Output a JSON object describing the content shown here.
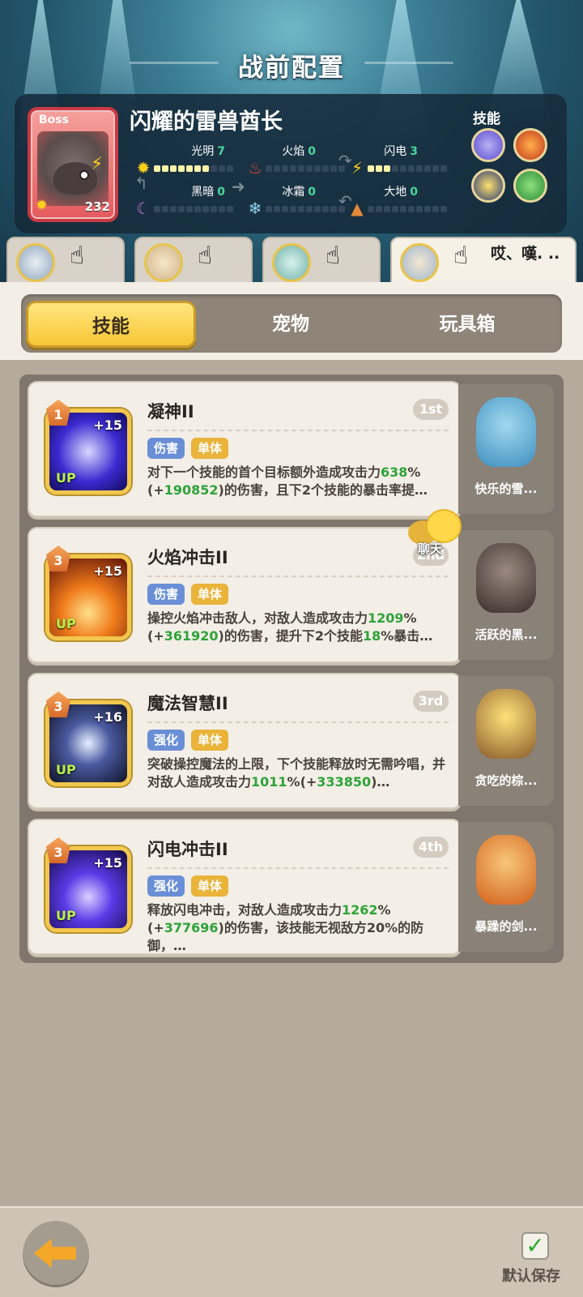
{
  "header": {
    "title": "战前配置"
  },
  "boss": {
    "tag": "Boss",
    "name": "闪耀的雷兽酋长",
    "level": "232",
    "elements": [
      {
        "label": "光明",
        "value": "7",
        "filled": 7,
        "icon": "sun-icon"
      },
      {
        "label": "火焰",
        "value": "0",
        "filled": 0,
        "icon": "fire-icon"
      },
      {
        "label": "闪电",
        "value": "3",
        "filled": 3,
        "icon": "lightning-icon"
      },
      {
        "label": "黑暗",
        "value": "0",
        "filled": 0,
        "icon": "moon-icon"
      },
      {
        "label": "冰霜",
        "value": "0",
        "filled": 0,
        "icon": "snowflake-icon"
      },
      {
        "label": "大地",
        "value": "0",
        "filled": 0,
        "icon": "earth-icon"
      }
    ],
    "skills_label": "技能"
  },
  "party": {
    "note": "哎、嘆. .."
  },
  "tabs": [
    {
      "label": "技能",
      "active": true
    },
    {
      "label": "宠物",
      "active": false
    },
    {
      "label": "玩具箱",
      "active": false
    }
  ],
  "skills": [
    {
      "name": "凝神II",
      "rank": "1st",
      "level": "1",
      "plus": "+15",
      "up": "UP",
      "tags": [
        "伤害",
        "单体"
      ],
      "desc": [
        [
          "对下一个技能的首个目标额外造成攻击力",
          ""
        ],
        [
          "638",
          "g"
        ],
        [
          "%(+",
          ""
        ],
        [
          "190852",
          "g"
        ],
        [
          ")的伤害，且下2个技能的暴击率提…",
          ""
        ]
      ],
      "pet": "快乐的雪..."
    },
    {
      "name": "火焰冲击II",
      "rank": "2nd",
      "level": "3",
      "plus": "+15",
      "up": "UP",
      "tags": [
        "伤害",
        "单体"
      ],
      "desc": [
        [
          "操控火焰冲击敌人，对敌人造成攻击力",
          ""
        ],
        [
          "1209",
          "g"
        ],
        [
          "%(+",
          ""
        ],
        [
          "361920",
          "g"
        ],
        [
          ")的伤害，提升下2个技能",
          ""
        ],
        [
          "18",
          "g"
        ],
        [
          "%暴击…",
          ""
        ]
      ],
      "pet": "活跃的黑..."
    },
    {
      "name": "魔法智慧II",
      "rank": "3rd",
      "level": "3",
      "plus": "+16",
      "up": "UP",
      "tags": [
        "强化",
        "单体"
      ],
      "desc": [
        [
          "突破操控魔法的上限，下个技能释放时无需吟唱，并对敌人造成攻击力",
          ""
        ],
        [
          "1011",
          "g"
        ],
        [
          "%(+",
          ""
        ],
        [
          "333850",
          "g"
        ],
        [
          ")…",
          ""
        ]
      ],
      "pet": "贪吃的棕..."
    },
    {
      "name": "闪电冲击II",
      "rank": "4th",
      "level": "3",
      "plus": "+15",
      "up": "UP",
      "tags": [
        "强化",
        "单体"
      ],
      "desc": [
        [
          "释放闪电冲击，对敌人造成攻击力",
          ""
        ],
        [
          "1262",
          "g"
        ],
        [
          "%(+",
          ""
        ],
        [
          "377696",
          "g"
        ],
        [
          ")的伤害，该技能无视敌方20%的防御，…",
          ""
        ]
      ],
      "pet": "暴躁的剑..."
    }
  ],
  "chat": {
    "label": "聊天"
  },
  "footer": {
    "save_label": "默认保存",
    "save_checked": true
  }
}
